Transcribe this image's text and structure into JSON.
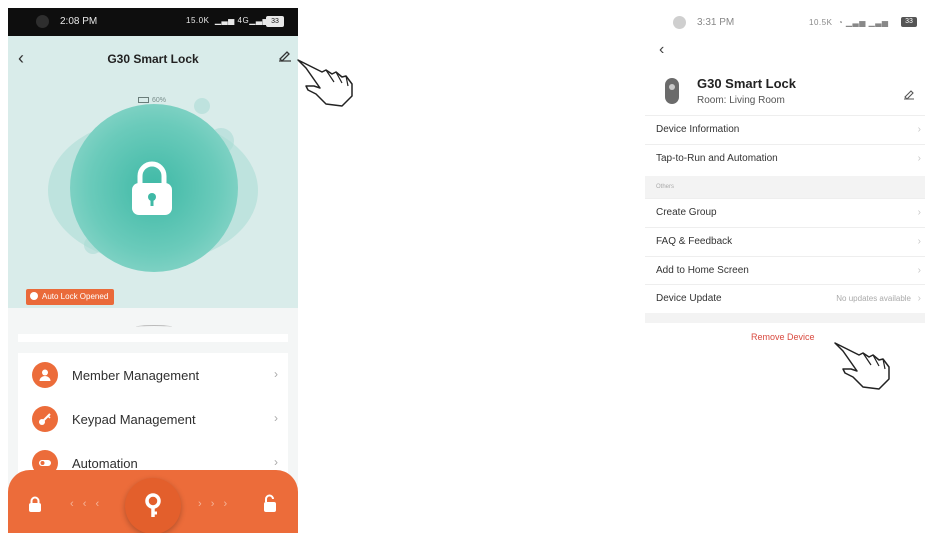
{
  "left_screen": {
    "status_bar": {
      "time": "2:08 PM",
      "net": "15.0K",
      "signal": "4G",
      "battery": "33"
    },
    "title": "G30 Smart Lock",
    "battery_indicator": "60%",
    "auto_lock_badge": "Auto Lock Opened",
    "menu": [
      {
        "label": "Member Management",
        "icon": "person-icon"
      },
      {
        "label": "Keypad Management",
        "icon": "key-icon"
      },
      {
        "label": "Automation",
        "icon": "toggle-icon"
      }
    ],
    "bottom_bar": {
      "left_arrows": "‹ ‹ ‹",
      "right_arrows": "› › ›"
    }
  },
  "right_screen": {
    "status_bar": {
      "time": "3:31 PM",
      "net": "10.5K",
      "battery": "33"
    },
    "device": {
      "title": "G30 Smart Lock",
      "room": "Room: Living Room"
    },
    "rows_top": [
      "Device Information",
      "Tap-to-Run and Automation"
    ],
    "section_label": "Others",
    "rows_others": [
      "Create Group",
      "FAQ & Feedback",
      "Add to Home Screen"
    ],
    "device_update": {
      "label": "Device Update",
      "value": "No updates available"
    },
    "remove_label": "Remove Device"
  },
  "colors": {
    "accent": "#ec6c3a",
    "teal": "#3fb9a6",
    "remove": "#d94a3f"
  }
}
